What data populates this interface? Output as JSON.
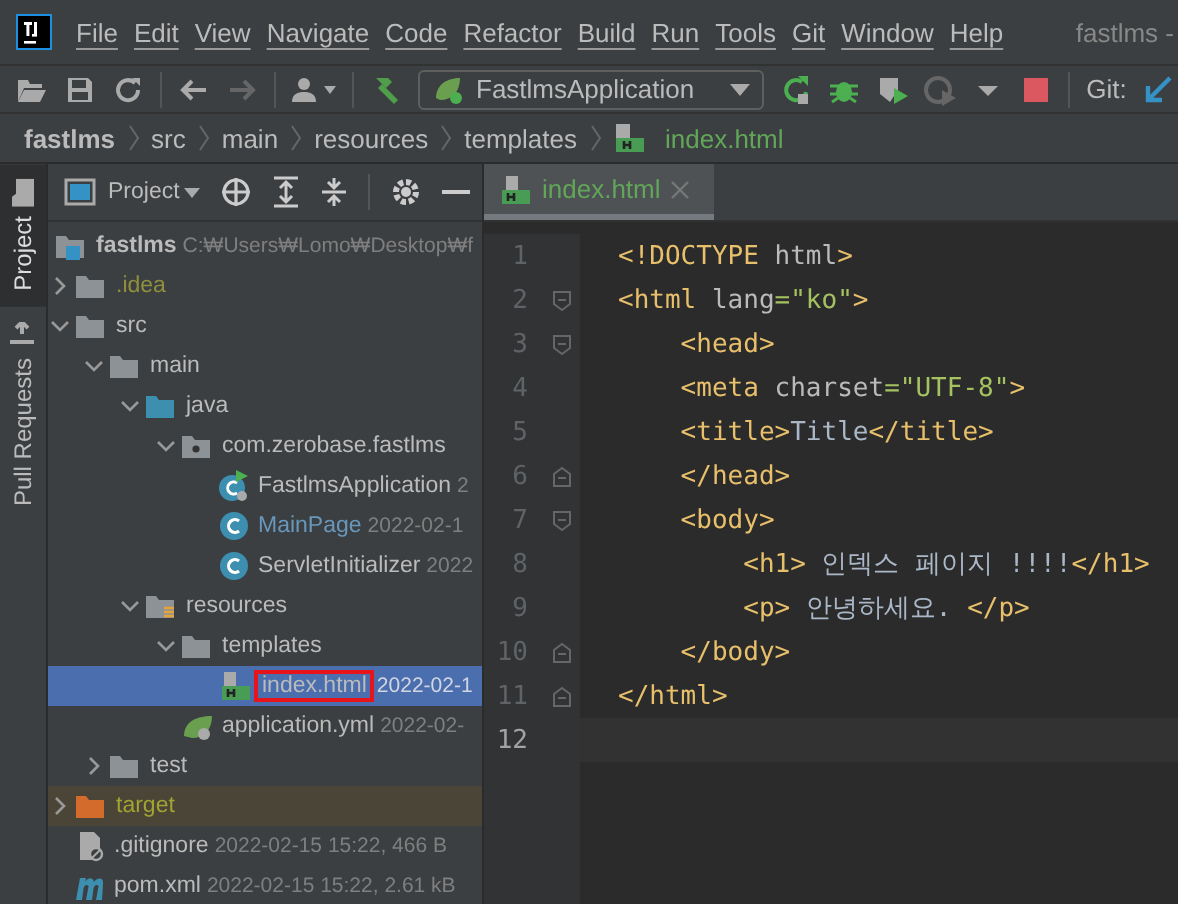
{
  "menu": {
    "items": [
      "File",
      "Edit",
      "View",
      "Navigate",
      "Code",
      "Refactor",
      "Build",
      "Run",
      "Tools",
      "Git",
      "Window",
      "Help"
    ],
    "title": "fastlms -"
  },
  "toolbar": {
    "run_config": "FastlmsApplication",
    "git_label": "Git:"
  },
  "breadcrumb": [
    "fastlms",
    "src",
    "main",
    "resources",
    "templates",
    "index.html"
  ],
  "side_tabs": [
    {
      "label": "Project",
      "selected": true
    },
    {
      "label": "Pull Requests",
      "selected": false
    }
  ],
  "project": {
    "title": "Project",
    "tree": [
      {
        "name": "fastlms",
        "kind": "module",
        "meta": "C:₩Users₩Lomo₩Desktop₩f",
        "children": [
          {
            "name": ".idea",
            "kind": "folder",
            "expanded": false,
            "color": "#8f8f3c"
          },
          {
            "name": "src",
            "kind": "folder",
            "expanded": true,
            "children": [
              {
                "name": "main",
                "kind": "folder",
                "expanded": true,
                "children": [
                  {
                    "name": "java",
                    "kind": "source",
                    "expanded": true,
                    "children": [
                      {
                        "name": "com.zerobase.fastlms",
                        "kind": "package",
                        "expanded": true,
                        "children": [
                          {
                            "name": "FastlmsApplication",
                            "kind": "app",
                            "meta": "2",
                            "color": "#bbbbbb"
                          },
                          {
                            "name": "MainPage",
                            "kind": "class",
                            "meta": "2022-02-1",
                            "color": "#6897bb"
                          },
                          {
                            "name": "ServletInitializer",
                            "kind": "class",
                            "meta": "2022",
                            "color": "#bbbbbb"
                          }
                        ]
                      }
                    ]
                  },
                  {
                    "name": "resources",
                    "kind": "resources",
                    "expanded": true,
                    "children": [
                      {
                        "name": "templates",
                        "kind": "folder",
                        "expanded": true,
                        "children": [
                          {
                            "name": "index.html",
                            "kind": "html",
                            "meta": "2022-02-1",
                            "selected": true,
                            "boxed": true,
                            "color": "#bbbbbb"
                          }
                        ]
                      },
                      {
                        "name": "application.yml",
                        "kind": "yml",
                        "meta": "2022-02-",
                        "color": "#bbbbbb"
                      }
                    ]
                  }
                ]
              },
              {
                "name": "test",
                "kind": "folder",
                "expanded": false
              }
            ]
          },
          {
            "name": "target",
            "kind": "excluded",
            "expanded": false,
            "color": "#a3a333"
          },
          {
            "name": ".gitignore",
            "kind": "ignore",
            "meta": "2022-02-15 15:22, 466 B",
            "color": "#bbbbbb"
          },
          {
            "name": "pom.xml",
            "kind": "maven",
            "meta": "2022-02-15 15:22, 2.61 kB",
            "color": "#bbbbbb"
          }
        ]
      }
    ]
  },
  "editor": {
    "tab": "index.html",
    "lines": [
      {
        "number": "1",
        "tokens": [
          {
            "kind": "tag",
            "text": "<!DOCTYPE "
          },
          {
            "kind": "attr",
            "text": "html"
          },
          {
            "kind": "tag",
            "text": ">"
          }
        ]
      },
      {
        "number": "2",
        "fold_open": true,
        "tokens": [
          {
            "kind": "tag",
            "text": "<html "
          },
          {
            "kind": "attr",
            "text": "lang"
          },
          {
            "kind": "value",
            "text": "=\"ko\""
          },
          {
            "kind": "tag",
            "text": ">"
          }
        ]
      },
      {
        "number": "3",
        "fold_open": true,
        "tokens": [
          {
            "kind": "tag",
            "text": "    <head>"
          }
        ]
      },
      {
        "number": "4",
        "tokens": [
          {
            "kind": "tag",
            "text": "    <meta "
          },
          {
            "kind": "attr",
            "text": "charset"
          },
          {
            "kind": "value",
            "text": "=\"UTF-8\""
          },
          {
            "kind": "tag",
            "text": ">"
          }
        ]
      },
      {
        "number": "5",
        "tokens": [
          {
            "kind": "tag",
            "text": "    <title>"
          },
          {
            "kind": "text",
            "text": "Title"
          },
          {
            "kind": "tag",
            "text": "</title>"
          }
        ]
      },
      {
        "number": "6",
        "fold_close": true,
        "tokens": [
          {
            "kind": "tag",
            "text": "    </head>"
          }
        ]
      },
      {
        "number": "7",
        "fold_open": true,
        "tokens": [
          {
            "kind": "tag",
            "text": "    <body>"
          }
        ]
      },
      {
        "number": "8",
        "tokens": [
          {
            "kind": "tag",
            "text": "        <h1>"
          },
          {
            "kind": "text",
            "text": " 인덱스 페이지 !!!!"
          },
          {
            "kind": "tag",
            "text": "</h1>"
          }
        ]
      },
      {
        "number": "9",
        "tokens": [
          {
            "kind": "tag",
            "text": "        <p>"
          },
          {
            "kind": "text",
            "text": " 안녕하세요. "
          },
          {
            "kind": "tag",
            "text": "</p>"
          }
        ]
      },
      {
        "number": "10",
        "fold_close": true,
        "tokens": [
          {
            "kind": "tag",
            "text": "    </body>"
          }
        ]
      },
      {
        "number": "11",
        "fold_close": true,
        "tokens": [
          {
            "kind": "tag",
            "text": "</html>"
          }
        ]
      },
      {
        "number": "12",
        "current": true
      }
    ]
  }
}
